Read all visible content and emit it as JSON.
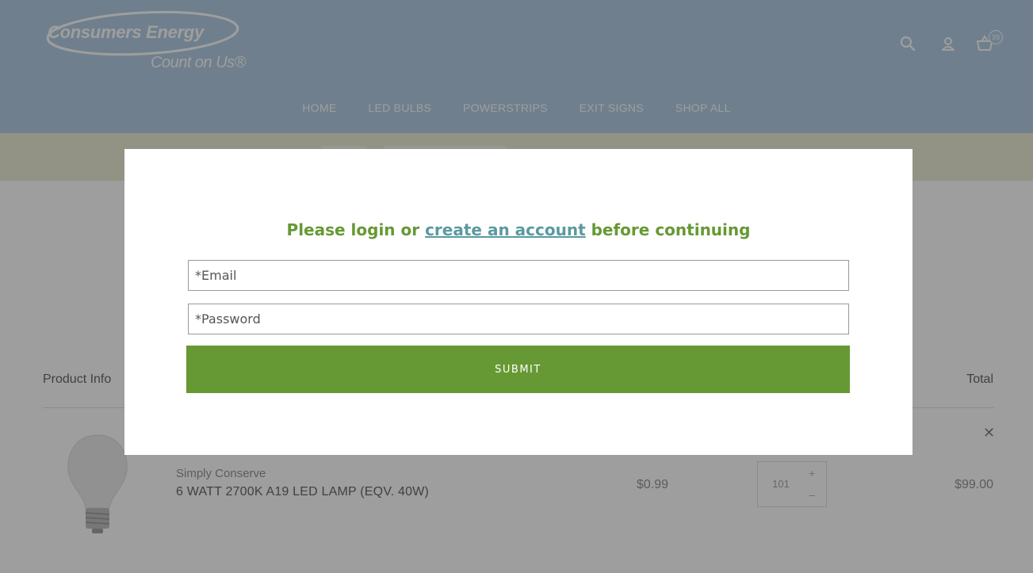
{
  "brand": {
    "name": "Consumers Energy",
    "tagline": "Count on Us®"
  },
  "header": {
    "cart_count": "99"
  },
  "nav": {
    "items": [
      "HOME",
      "LED BULBS",
      "POWERSTRIPS",
      "EXIT SIGNS",
      "SHOP ALL"
    ]
  },
  "cart": {
    "headers": {
      "product": "Product Info",
      "total": "Total"
    },
    "item": {
      "vendor": "Simply Conserve",
      "title": "6 WATT 2700K A19 LED LAMP (EQV. 40W)",
      "price": "$0.99",
      "quantity": "101",
      "total": "$99.00"
    }
  },
  "modal": {
    "heading_before": "Please login or ",
    "heading_link": "create an account",
    "heading_after": " before continuing",
    "email_placeholder": "*Email",
    "password_placeholder": "*Password",
    "submit_label": "SUBMIT"
  },
  "colors": {
    "header_bg": "#aac6e0",
    "accent_green": "#669933",
    "link_teal": "#5a9a9f"
  },
  "icons": {
    "search": "search-icon",
    "account": "user-icon",
    "cart": "basket-icon",
    "remove": "close-icon",
    "plus": "plus-icon",
    "minus": "minus-icon"
  }
}
